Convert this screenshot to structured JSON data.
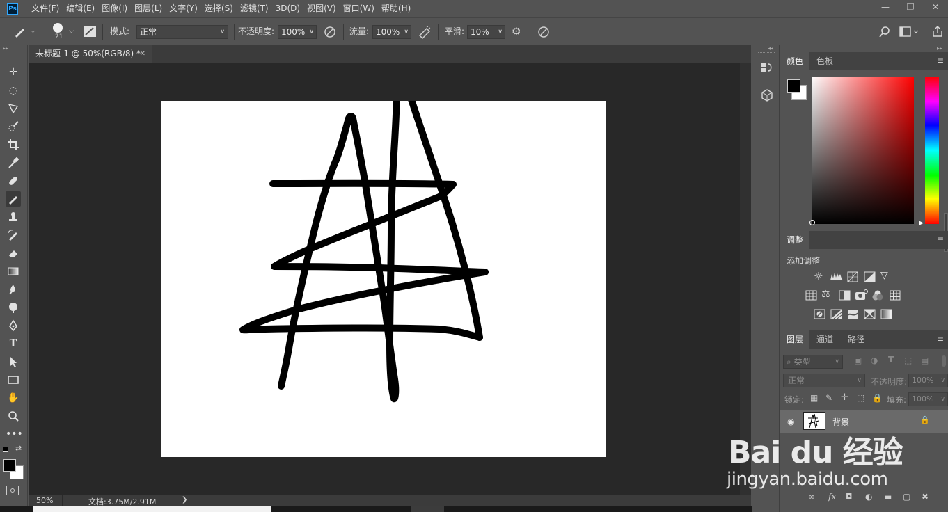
{
  "app": {
    "logo": "Ps"
  },
  "menu": [
    "文件(F)",
    "编辑(E)",
    "图像(I)",
    "图层(L)",
    "文字(Y)",
    "选择(S)",
    "滤镜(T)",
    "3D(D)",
    "视图(V)",
    "窗口(W)",
    "帮助(H)"
  ],
  "options": {
    "brush_size": "21",
    "mode_label": "模式:",
    "mode_value": "正常",
    "opacity_label": "不透明度:",
    "opacity_value": "100%",
    "flow_label": "流量:",
    "flow_value": "100%",
    "smooth_label": "平滑:",
    "smooth_value": "10%"
  },
  "document": {
    "tab_title": "未标题-1 @ 50%(RGB/8) *",
    "zoom": "50%",
    "doc_info": "文档:3.75M/2.91M"
  },
  "color_panel": {
    "tabs": [
      "颜色",
      "色板"
    ]
  },
  "adjust_panel": {
    "tab": "调整",
    "add_label": "添加调整"
  },
  "layers_panel": {
    "tabs": [
      "图层",
      "通道",
      "路径"
    ],
    "filter_placeholder": "类型",
    "blend_mode": "正常",
    "opacity_label": "不透明度:",
    "opacity_value": "100%",
    "lock_label": "锁定:",
    "fill_label": "填充:",
    "fill_value": "100%",
    "layer_name": "背景"
  },
  "watermark": {
    "brand": "Bai du 经验",
    "url": "jingyan.baidu.com"
  },
  "colors": {
    "foreground": "#000000",
    "background": "#ffffff"
  }
}
